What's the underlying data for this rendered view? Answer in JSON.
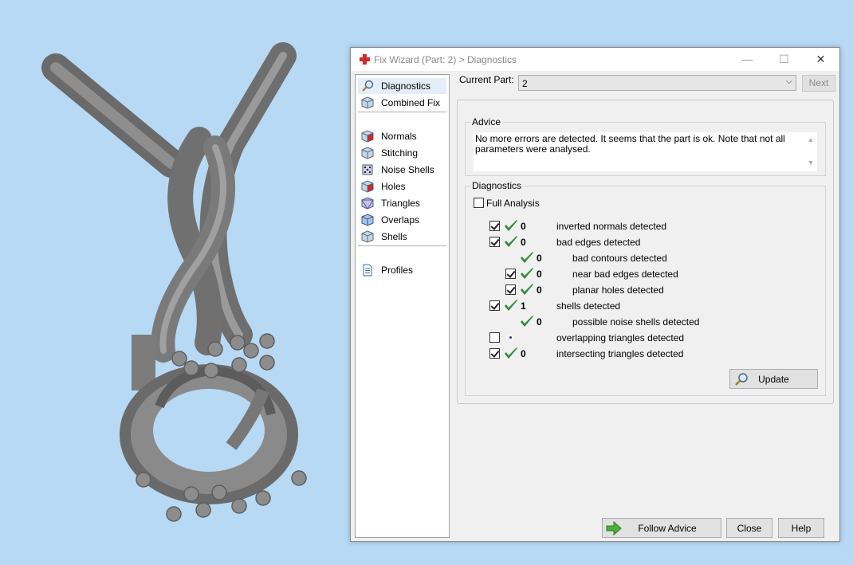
{
  "window": {
    "title": "Fix Wizard (Part: 2) > Diagnostics",
    "controls": {
      "minimize": "—",
      "maximize": "☐",
      "close": "✕"
    }
  },
  "sidebar": {
    "groups": [
      [
        {
          "label": "Diagnostics",
          "icon": "magnifier-icon",
          "selected": true
        },
        {
          "label": "Combined Fix",
          "icon": "cube-icon"
        }
      ],
      [
        {
          "label": "Normals",
          "icon": "cube-red-icon"
        },
        {
          "label": "Stitching",
          "icon": "cube-icon"
        },
        {
          "label": "Noise Shells",
          "icon": "dice-icon"
        },
        {
          "label": "Holes",
          "icon": "cube-red-icon"
        },
        {
          "label": "Triangles",
          "icon": "triangle-cube-icon"
        },
        {
          "label": "Overlaps",
          "icon": "cube-blue-icon"
        },
        {
          "label": "Shells",
          "icon": "cube-icon"
        }
      ],
      [
        {
          "label": "Profiles",
          "icon": "document-icon"
        }
      ]
    ]
  },
  "current_part": {
    "label": "Current Part:",
    "value": "2",
    "next_label": "Next"
  },
  "advice": {
    "title": "Advice",
    "text": "No more errors are detected. It seems that the part is ok. Note that not all parameters were analysed."
  },
  "diagnostics": {
    "title": "Diagnostics",
    "full_analysis": {
      "label": "Full Analysis",
      "checked": false
    },
    "rows": [
      {
        "checkbox": true,
        "checked": true,
        "status": "ok",
        "count": "0",
        "label": "inverted normals detected",
        "indent": 0
      },
      {
        "checkbox": true,
        "checked": true,
        "status": "ok",
        "count": "0",
        "label": "bad edges detected",
        "indent": 0
      },
      {
        "checkbox": false,
        "checked": false,
        "status": "ok",
        "count": "0",
        "label": "bad contours detected",
        "indent": 1
      },
      {
        "checkbox": true,
        "checked": true,
        "status": "ok",
        "count": "0",
        "label": "near bad edges detected",
        "indent": 1
      },
      {
        "checkbox": true,
        "checked": true,
        "status": "ok",
        "count": "0",
        "label": "planar holes detected",
        "indent": 1
      },
      {
        "checkbox": true,
        "checked": true,
        "status": "ok",
        "count": "1",
        "label": "shells detected",
        "indent": 0
      },
      {
        "checkbox": false,
        "checked": false,
        "status": "ok",
        "count": "0",
        "label": "possible noise shells detected",
        "indent": 1
      },
      {
        "checkbox": true,
        "checked": false,
        "status": "dot",
        "count": "",
        "label": "overlapping triangles detected",
        "indent": 0
      },
      {
        "checkbox": true,
        "checked": true,
        "status": "ok",
        "count": "0",
        "label": "intersecting triangles detected",
        "indent": 0
      }
    ],
    "update_label": "Update"
  },
  "footer": {
    "follow_advice": "Follow Advice",
    "close": "Close",
    "help": "Help"
  },
  "colors": {
    "background": "#b7d9f4",
    "model": "#7a7a7a",
    "tick": "#2e8b3a"
  }
}
